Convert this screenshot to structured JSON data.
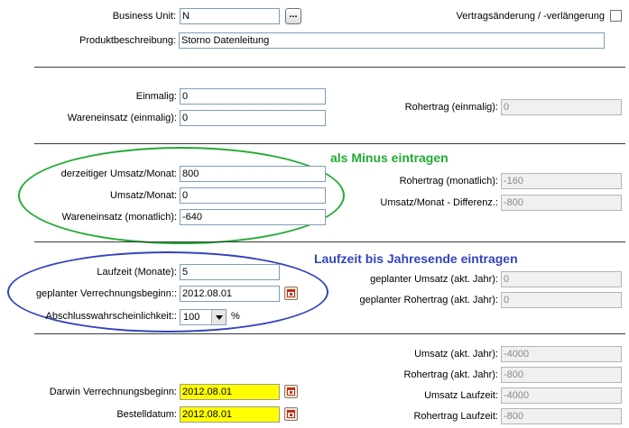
{
  "top": {
    "business_unit_label": "Business Unit:",
    "business_unit_value": "N",
    "browse_button_label": "...",
    "vertragsaenderung_label": "Vertragsänderung / -verlängerung",
    "produktbeschreibung_label": "Produktbeschreibung:",
    "produktbeschreibung_value": "Storno Datenleitung"
  },
  "einmalig": {
    "einmalig_label": "Einmalig:",
    "einmalig_value": "0",
    "wareneinsatz_label": "Wareneinsatz (einmalig):",
    "wareneinsatz_value": "0",
    "rohertrag_label": "Rohertrag (einmalig):",
    "rohertrag_value": "0"
  },
  "monatlich": {
    "annotation": "als Minus eintragen",
    "annotation_color": "#22aa33",
    "derzeitiger_umsatz_label": "derzeitiger Umsatz/Monat:",
    "derzeitiger_umsatz_value": "800",
    "umsatz_label": "Umsatz/Monat:",
    "umsatz_value": "0",
    "wareneinsatz_label": "Wareneinsatz (monatlich):",
    "wareneinsatz_value": "-640",
    "rohertrag_label": "Rohertrag (monatlich):",
    "rohertrag_value": "-160",
    "differenz_label": "Umsatz/Monat - Differenz.:",
    "differenz_value": "-800"
  },
  "laufzeit": {
    "annotation": "Laufzeit bis Jahresende eintragen",
    "annotation_color": "#3344bb",
    "laufzeit_label": "Laufzeit (Monate):",
    "laufzeit_value": "5",
    "verrechnungsbeginn_label": "geplanter Verrechnungsbeginn::",
    "verrechnungsbeginn_value": "2012.08.01",
    "abschluss_label": "Abschlusswahrscheinlichkeit::",
    "abschluss_value": "100",
    "abschluss_unit": "%",
    "geplanter_umsatz_label": "geplanter Umsatz (akt. Jahr):",
    "geplanter_umsatz_value": "0",
    "geplanter_rohertrag_label": "geplanter Rohertrag (akt. Jahr):",
    "geplanter_rohertrag_value": "0"
  },
  "summary": {
    "umsatz_akt_label": "Umsatz (akt. Jahr):",
    "umsatz_akt_value": "-4000",
    "rohertrag_akt_label": "Rohertrag (akt. Jahr):",
    "rohertrag_akt_value": "-800",
    "umsatz_laufzeit_label": "Umsatz Laufzeit:",
    "umsatz_laufzeit_value": "-4000",
    "rohertrag_laufzeit_label": "Rohertrag Laufzeit:",
    "rohertrag_laufzeit_value": "-800",
    "darwin_label": "Darwin Verrechnungsbeginn:",
    "darwin_value": "2012.08.01",
    "bestelldatum_label": "Bestelldatum:",
    "bestelldatum_value": "2012.08.01"
  },
  "colors": {
    "green_ellipse": "#22aa33",
    "blue_ellipse": "#3344bb",
    "highlight_field": "#ffff00"
  }
}
